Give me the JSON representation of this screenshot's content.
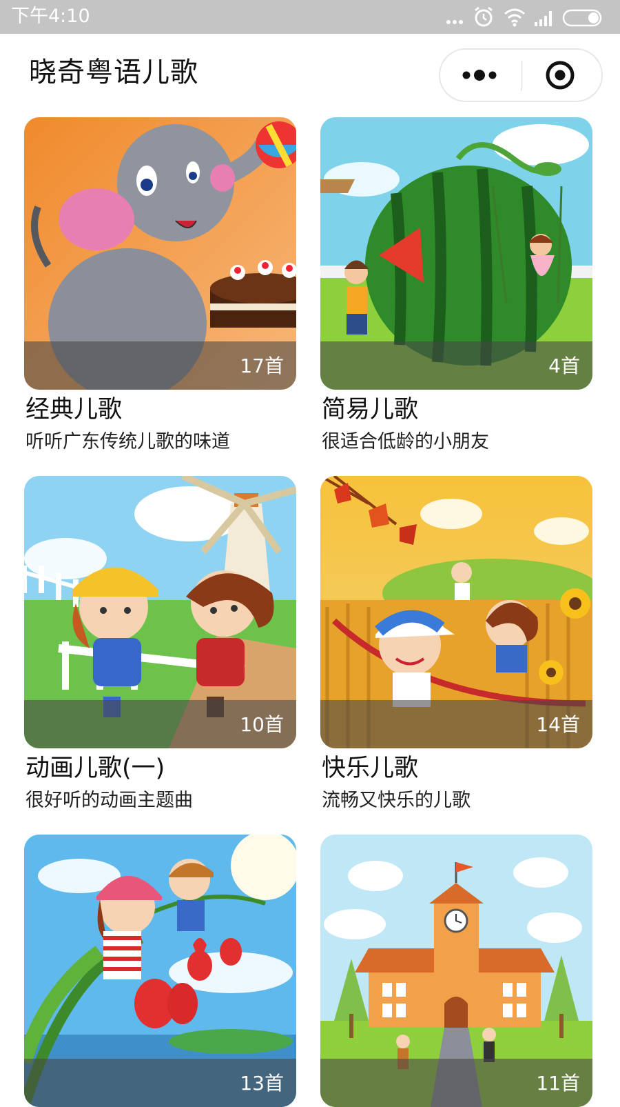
{
  "status_bar": {
    "time": "下午4:10",
    "icons": [
      "more-dots-icon",
      "alarm-icon",
      "wifi-icon",
      "signal-icon",
      "battery-icon"
    ]
  },
  "nav": {
    "title": "晓奇粤语儿歌",
    "capsule_icons": [
      "more-icon",
      "close-target-icon"
    ]
  },
  "colors": {
    "status_bar_bg": "#c4c4c4",
    "count_overlay": "rgba(70,70,70,0.58)",
    "title_text": "#111111"
  },
  "albums": [
    {
      "title": "经典儿歌",
      "subtitle": "听听广东传统儿歌的味道",
      "count": "17首",
      "image": "cartoon elephant with cake and ball"
    },
    {
      "title": "简易儿歌",
      "subtitle": "很适合低龄的小朋友",
      "count": "4首",
      "image": "kids playing with giant watermelon"
    },
    {
      "title": "动画儿歌(一)",
      "subtitle": "很好听的动画主题曲",
      "count": "10首",
      "image": "kids roller skating near windmill"
    },
    {
      "title": "快乐儿歌",
      "subtitle": "流畅又快乐的儿歌",
      "count": "14首",
      "image": "kids running in autumn field"
    },
    {
      "title": "",
      "subtitle": "",
      "count": "13首",
      "image": "kids on flower stem with lanterns"
    },
    {
      "title": "",
      "subtitle": "",
      "count": "11首",
      "image": "school building with clock tower"
    }
  ]
}
